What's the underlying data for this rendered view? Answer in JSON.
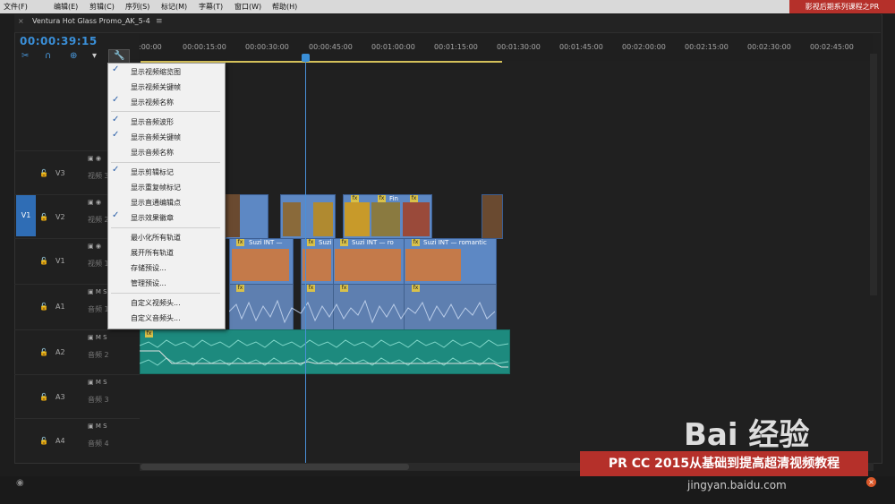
{
  "menubar": {
    "items": [
      "文件(F)",
      "编辑(E)",
      "剪辑(C)",
      "序列(S)",
      "标记(M)",
      "字幕(T)",
      "窗口(W)",
      "帮助(H)"
    ],
    "brand": "影视后期系列课程之PR"
  },
  "sequence": {
    "tab_label": "Ventura Hot Glass Promo_AK_5-4",
    "tab_menu": "≡",
    "timecode": "00:00:39:15"
  },
  "ruler": {
    "labels": [
      ":00:00",
      "00:00:15:00",
      "00:00:30:00",
      "00:00:45:00",
      "00:01:00:00",
      "00:01:15:00",
      "00:01:30:00",
      "00:01:45:00",
      "00:02:00:00",
      "00:02:15:00",
      "00:02:30:00",
      "00:02:45:00"
    ]
  },
  "tracks": [
    {
      "id": "V3",
      "name": "视频 3",
      "kind": "video"
    },
    {
      "id": "V2",
      "name": "视频 2",
      "kind": "video"
    },
    {
      "id": "V1",
      "name": "视频 1",
      "kind": "video"
    },
    {
      "id": "A1",
      "name": "音频 1",
      "kind": "audio"
    },
    {
      "id": "A2",
      "name": "音频 2",
      "kind": "audio"
    },
    {
      "id": "A3",
      "name": "音频 3",
      "kind": "audio"
    },
    {
      "id": "A4",
      "name": "音频 4",
      "kind": "audio"
    }
  ],
  "track_target": "V1",
  "clips": {
    "v1_labels": [
      "Suzi INT —",
      "Suzi",
      "Suzi INT — ro",
      "Suzi INT — romantic"
    ],
    "v2_label": "Fin",
    "fx": "fx"
  },
  "dropdown": {
    "items": [
      {
        "label": "显示视频缩览图",
        "checked": true
      },
      {
        "label": "显示视频关键帧",
        "checked": false
      },
      {
        "label": "显示视频名称",
        "checked": true
      },
      {
        "label": "显示音频波形",
        "checked": true
      },
      {
        "label": "显示音频关键帧",
        "checked": true
      },
      {
        "label": "显示音频名称",
        "checked": false
      },
      {
        "label": "显示剪辑标记",
        "checked": true
      },
      {
        "label": "显示重复帧标记",
        "checked": false
      },
      {
        "label": "显示直通编辑点",
        "checked": false
      },
      {
        "label": "显示效果徽章",
        "checked": true
      },
      {
        "label": "最小化所有轨道",
        "checked": false
      },
      {
        "label": "展开所有轨道",
        "checked": false
      },
      {
        "label": "存储预设...",
        "checked": false
      },
      {
        "label": "管理预设...",
        "checked": false
      },
      {
        "label": "自定义视频头...",
        "checked": false
      },
      {
        "label": "自定义音频头...",
        "checked": false
      }
    ]
  },
  "watermark": {
    "logo": "Bai 经验",
    "promo": "PR CC 2015从基础到提高超清视频教程",
    "url": "jingyan.baidu.com"
  },
  "colors": {
    "accent": "#3a8fd8",
    "video_clip": "#5d88c4",
    "audio_clip_teal": "#1d8a7e",
    "brand_red": "#b5302a"
  }
}
